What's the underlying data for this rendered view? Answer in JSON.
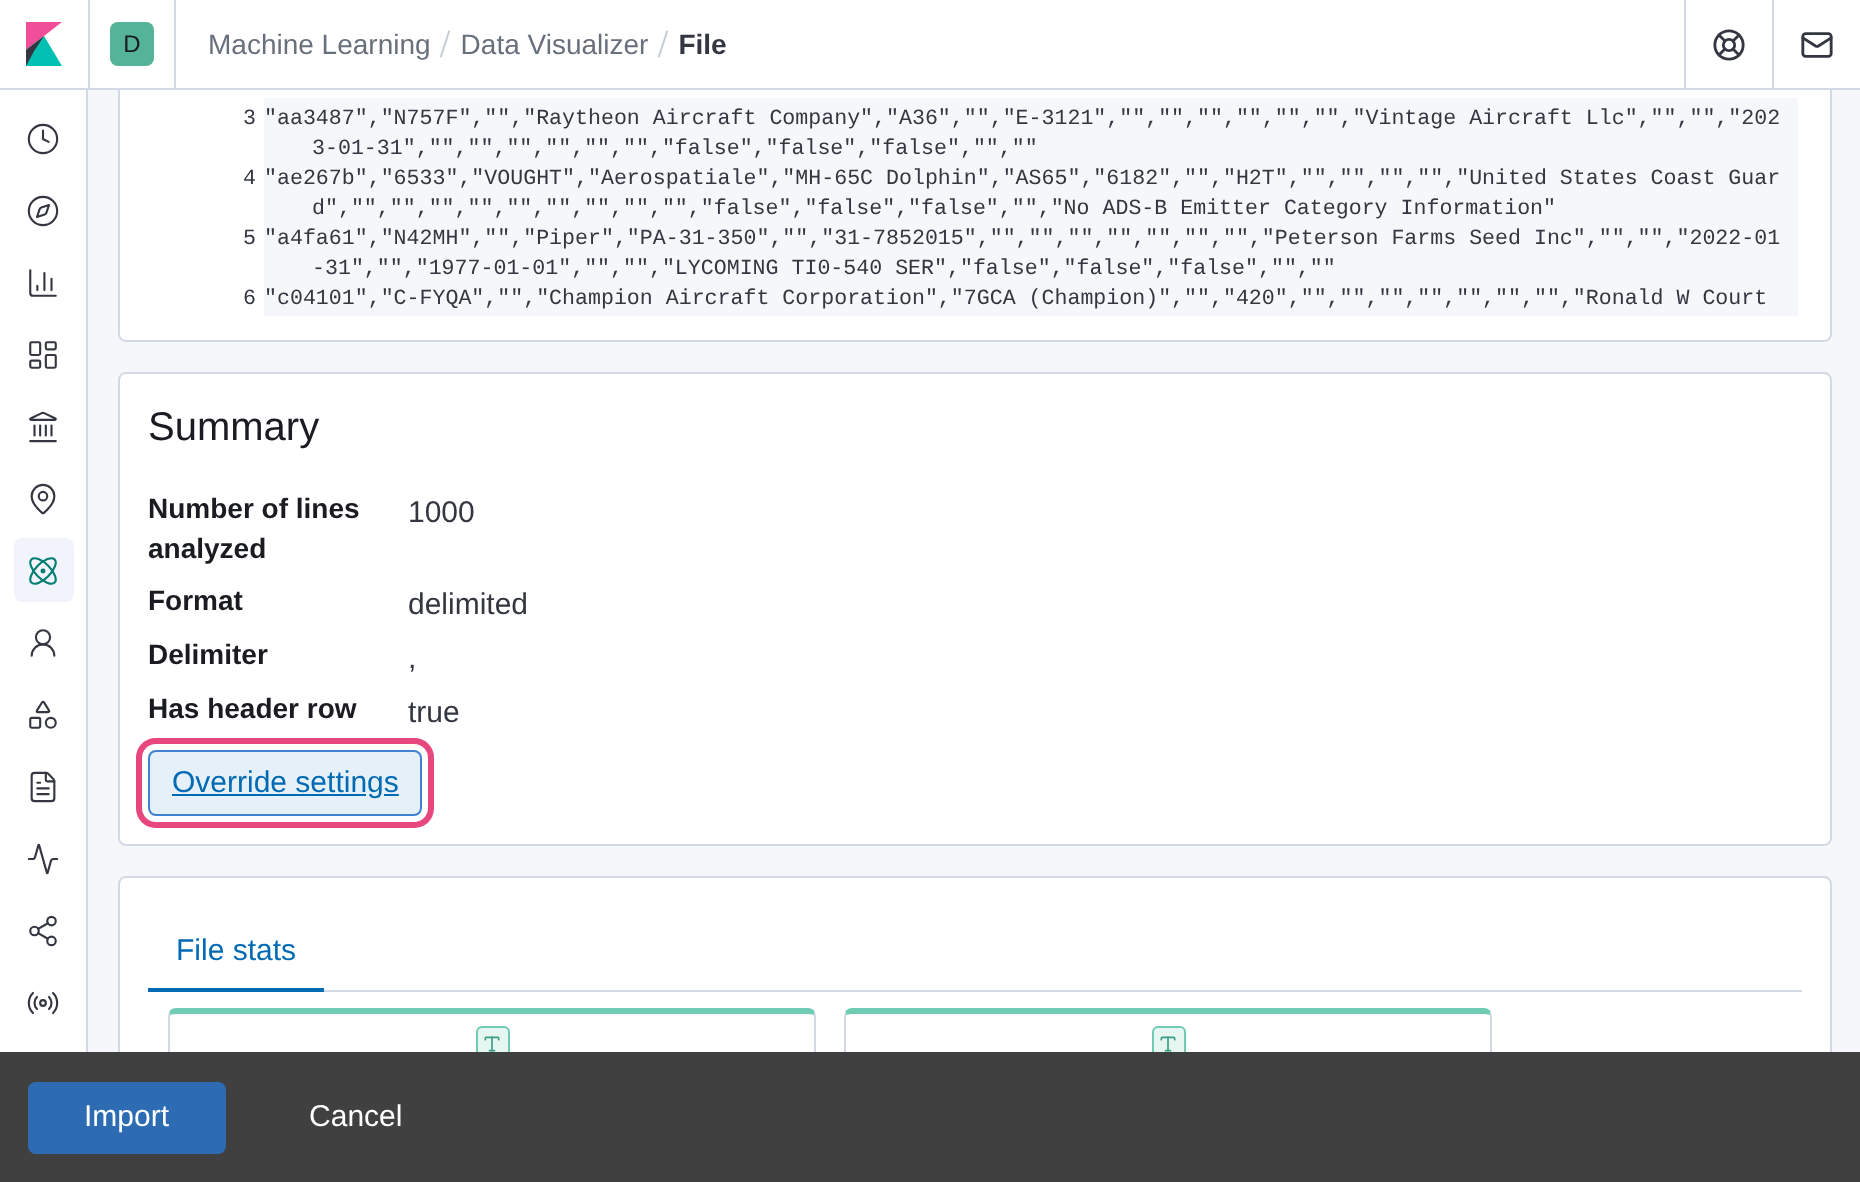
{
  "header": {
    "avatar": "D",
    "breadcrumbs": [
      {
        "label": "Machine Learning",
        "current": false
      },
      {
        "label": "Data Visualizer",
        "current": false
      },
      {
        "label": "File",
        "current": true
      }
    ]
  },
  "sidebar": {
    "items": [
      {
        "selected": false
      },
      {
        "selected": false
      },
      {
        "selected": false
      },
      {
        "selected": false
      },
      {
        "selected": false
      },
      {
        "selected": false
      },
      {
        "selected": true
      },
      {
        "selected": false
      },
      {
        "selected": false
      },
      {
        "selected": false
      },
      {
        "selected": false
      },
      {
        "selected": false
      },
      {
        "selected": false
      }
    ]
  },
  "file_contents": {
    "lines": [
      {
        "number": "3",
        "text": "\"aa3487\",\"N757F\",\"\",\"Raytheon Aircraft Company\",\"A36\",\"\",\"E-3121\",\"\",\"\",\"\",\"\",\"\",\"\",\"Vintage Aircraft Llc\",\"\",\"\",\"2023-01-31\",\"\",\"\",\"\",\"\",\"\",\"\",\"false\",\"false\",\"false\",\"\",\"\""
      },
      {
        "number": "4",
        "text": "\"ae267b\",\"6533\",\"VOUGHT\",\"Aerospatiale\",\"MH-65C Dolphin\",\"AS65\",\"6182\",\"\",\"H2T\",\"\",\"\",\"\",\"\",\"United States Coast Guard\",\"\",\"\",\"\",\"\",\"\",\"\",\"\",\"\",\"\",\"false\",\"false\",\"false\",\"\",\"No ADS-B Emitter Category Information\""
      },
      {
        "number": "5",
        "text": "\"a4fa61\",\"N42MH\",\"\",\"Piper\",\"PA-31-350\",\"\",\"31-7852015\",\"\",\"\",\"\",\"\",\"\",\"\",\"\",\"Peterson Farms Seed Inc\",\"\",\"\",\"2022-01-31\",\"\",\"1977-01-01\",\"\",\"\",\"LYCOMING TI0-540 SER\",\"false\",\"false\",\"false\",\"\",\"\""
      },
      {
        "number": "6",
        "text": "\"c04101\",\"C-FYQA\",\"\",\"Champion Aircraft Corporation\",\"7GCA (Champion)\",\"\",\"420\",\"\",\"\",\"\",\"\",\"\",\"\",\"\",\"Ronald W Court"
      }
    ]
  },
  "summary": {
    "title": "Summary",
    "rows": [
      {
        "label": "Number of lines analyzed",
        "value": "1000"
      },
      {
        "label": "Format",
        "value": "delimited"
      },
      {
        "label": "Delimiter",
        "value": ","
      },
      {
        "label": "Has header row",
        "value": "true"
      }
    ],
    "button": "Override settings"
  },
  "stats": {
    "tabs": [
      {
        "label": "File stats",
        "selected": true
      }
    ],
    "cards": [
      {
        "kind": "field"
      },
      {
        "kind": "field"
      }
    ]
  },
  "footer": {
    "buttons": [
      {
        "label": "Import",
        "kind": "primary"
      },
      {
        "label": "Cancel",
        "kind": "empty"
      }
    ]
  }
}
